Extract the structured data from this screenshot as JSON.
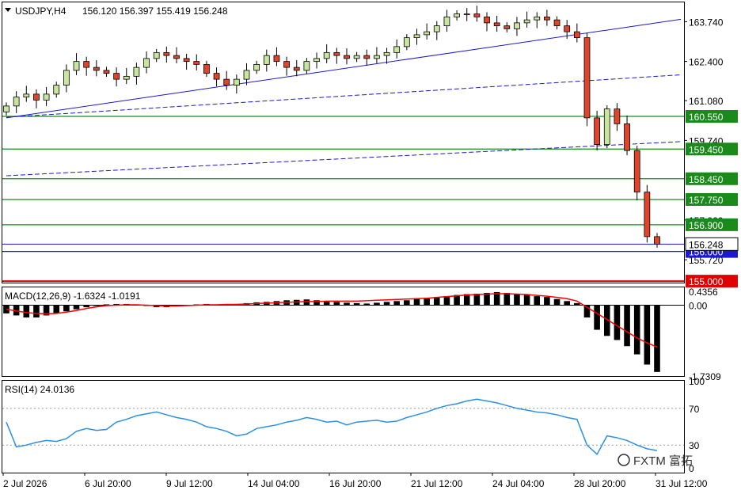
{
  "header": {
    "symbol": "USDJPY,H4",
    "ohlc": "156.120 156.397 155.419 156.248"
  },
  "colors": {
    "bull": "#c8e6a0",
    "bear": "#e0442a",
    "candle_outline": "#000000",
    "trend": "#1a1acc",
    "level": "#1a8a1a",
    "current": "#1a1acc",
    "macd_signal": "#ff0000",
    "rsi": "#2b8fe6"
  },
  "chart_data": [
    {
      "type": "candlestick",
      "title": "USDJPY,H4",
      "y_ticks": [
        163.74,
        162.4,
        161.08,
        159.74,
        157.06,
        155.72
      ],
      "y_tick_labels": [
        "163.740",
        "162.400",
        "161.080",
        "159.740",
        "157.060",
        "155.720"
      ],
      "ylim": [
        154.95,
        164.39
      ],
      "x_tick_labels": [
        "2 Jul 2026",
        "6 Jul 20:00",
        "9 Jul 12:00",
        "14 Jul 04:00",
        "16 Jul 20:00",
        "21 Jul 12:00",
        "24 Jul 04:00",
        "28 Jul 20:00",
        "31 Jul 12:00"
      ],
      "levels": [
        {
          "label": "160.550",
          "value": 160.55
        },
        {
          "label": "159.450",
          "value": 159.45
        },
        {
          "label": "158.450",
          "value": 158.45
        },
        {
          "label": "157.750",
          "value": 157.75
        },
        {
          "label": "156.900",
          "value": 156.9
        },
        {
          "label": "156.000",
          "value": 156.0
        },
        {
          "label": "155.000",
          "value": 155.0
        }
      ],
      "current_price": {
        "label": "156.248",
        "value": 156.248
      },
      "close": [
        160.9,
        161.2,
        161.3,
        161.1,
        161.3,
        161.6,
        162.1,
        162.4,
        162.2,
        162.1,
        162.0,
        161.8,
        161.9,
        162.2,
        162.5,
        162.7,
        162.6,
        162.5,
        162.4,
        162.3,
        162.0,
        161.8,
        161.6,
        161.8,
        162.1,
        162.3,
        162.6,
        162.4,
        162.2,
        162.1,
        162.4,
        162.5,
        162.7,
        162.6,
        162.5,
        162.6,
        162.5,
        162.6,
        162.7,
        162.9,
        163.2,
        163.3,
        163.4,
        163.6,
        163.9,
        164.0,
        164.0,
        163.9,
        163.7,
        163.6,
        163.5,
        163.7,
        163.8,
        163.9,
        163.8,
        163.6,
        163.4,
        163.2,
        160.5,
        159.6,
        160.8,
        160.3,
        159.4,
        158.0,
        156.5,
        156.248
      ],
      "trendlines": [
        {
          "name": "upper",
          "from": [
            0,
            160.5
          ],
          "to": [
            65,
            163.82
          ]
        },
        {
          "name": "lower",
          "style": "dashed",
          "from": [
            0,
            158.55
          ],
          "to": [
            65,
            159.7
          ]
        },
        {
          "name": "mid",
          "style": "dashed",
          "from": [
            0,
            160.52
          ],
          "to": [
            65,
            161.95
          ]
        }
      ]
    },
    {
      "type": "macd",
      "title": "MACD(12,26,9) -1.6324 -1.0191",
      "y_tick_labels": [
        "0.4356",
        "0.00",
        "-1.7309"
      ],
      "ylim": [
        -1.73,
        0.435
      ],
      "histogram": [
        -0.2,
        -0.25,
        -0.3,
        -0.3,
        -0.25,
        -0.2,
        -0.15,
        -0.1,
        -0.05,
        0.0,
        0.02,
        0.03,
        0.03,
        0.02,
        0.0,
        -0.05,
        -0.05,
        -0.03,
        0.0,
        0.02,
        0.03,
        0.02,
        0.02,
        0.03,
        0.05,
        0.07,
        0.08,
        0.1,
        0.12,
        0.13,
        0.14,
        0.12,
        0.1,
        0.08,
        0.06,
        0.05,
        0.04,
        0.06,
        0.08,
        0.1,
        0.12,
        0.15,
        0.17,
        0.2,
        0.22,
        0.25,
        0.27,
        0.28,
        0.3,
        0.32,
        0.3,
        0.28,
        0.25,
        0.22,
        0.2,
        0.15,
        0.1,
        0.05,
        -0.3,
        -0.6,
        -0.75,
        -0.85,
        -1.0,
        -1.2,
        -1.45,
        -1.63
      ],
      "signal": [
        -0.1,
        -0.14,
        -0.18,
        -0.2,
        -0.21,
        -0.2,
        -0.17,
        -0.13,
        -0.08,
        -0.04,
        -0.01,
        0.0,
        0.01,
        0.01,
        0.0,
        -0.01,
        -0.02,
        -0.02,
        -0.01,
        0.0,
        0.01,
        0.01,
        0.02,
        0.02,
        0.03,
        0.04,
        0.05,
        0.06,
        0.07,
        0.08,
        0.09,
        0.09,
        0.1,
        0.1,
        0.1,
        0.1,
        0.11,
        0.12,
        0.13,
        0.14,
        0.15,
        0.16,
        0.17,
        0.19,
        0.21,
        0.23,
        0.25,
        0.26,
        0.27,
        0.28,
        0.28,
        0.27,
        0.26,
        0.24,
        0.22,
        0.19,
        0.16,
        0.1,
        -0.05,
        -0.2,
        -0.35,
        -0.5,
        -0.65,
        -0.8,
        -0.92,
        -1.02
      ]
    },
    {
      "type": "line",
      "title": "RSI(14) 24.0136",
      "y_tick_labels": [
        "100",
        "70",
        "30",
        "0"
      ],
      "ylim": [
        0,
        100
      ],
      "levels": [
        70,
        30
      ],
      "values": [
        55,
        28,
        30,
        33,
        35,
        34,
        37,
        45,
        48,
        46,
        47,
        55,
        58,
        62,
        64,
        66,
        63,
        60,
        58,
        55,
        50,
        48,
        45,
        40,
        42,
        48,
        50,
        52,
        55,
        57,
        60,
        58,
        55,
        56,
        52,
        55,
        56,
        57,
        55,
        56,
        60,
        63,
        66,
        70,
        73,
        75,
        78,
        80,
        78,
        76,
        73,
        70,
        68,
        66,
        65,
        63,
        60,
        58,
        30,
        20,
        40,
        38,
        35,
        30,
        26,
        24
      ]
    }
  ],
  "watermark": "FXTM 富拓"
}
